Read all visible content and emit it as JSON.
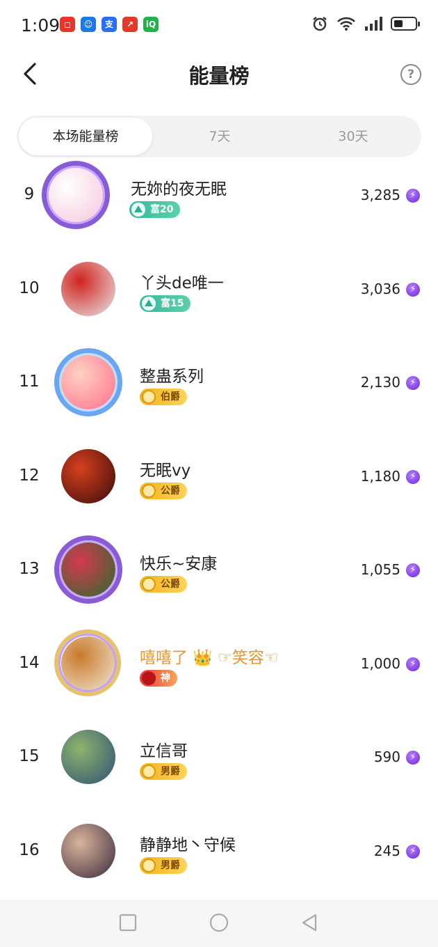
{
  "status_bar": {
    "time": "1:09",
    "notif_apps": [
      {
        "name": "app-icon-red",
        "color": "#e8342b",
        "glyph": "◻"
      },
      {
        "name": "app-icon-blue-bot",
        "color": "#1e78e6",
        "glyph": "☺"
      },
      {
        "name": "app-icon-alipay",
        "color": "#2a6ff0",
        "glyph": "支"
      },
      {
        "name": "app-icon-red-arrow",
        "color": "#e23a2a",
        "glyph": "↗"
      },
      {
        "name": "app-icon-iqiyi",
        "color": "#22b24c",
        "glyph": "iQ"
      }
    ]
  },
  "header": {
    "title": "能量榜",
    "help": "?"
  },
  "tabs": [
    {
      "label": "本场能量榜",
      "active": true
    },
    {
      "label": "7天",
      "active": false
    },
    {
      "label": "30天",
      "active": false
    }
  ],
  "rows": [
    {
      "rank": "9",
      "name": "无妳的夜无眠",
      "badge": "富20",
      "badge_type": "rich",
      "score": "3,285",
      "frame": "purple",
      "avatar_colors": [
        "#f5c6dc",
        "#ffffff"
      ]
    },
    {
      "rank": "10",
      "name": "丫头de唯一",
      "badge": "富15",
      "badge_type": "rich",
      "score": "3,036",
      "frame": "none",
      "avatar_colors": [
        "#e8e8e8",
        "#d0231f"
      ]
    },
    {
      "rank": "11",
      "name": "整蛊系列",
      "badge": "伯爵",
      "badge_type": "gold",
      "score": "2,130",
      "frame": "blue",
      "avatar_colors": [
        "#ff6f8c",
        "#ffd1c4"
      ]
    },
    {
      "rank": "12",
      "name": "无眠vy",
      "badge": "公爵",
      "badge_type": "gold",
      "score": "1,180",
      "frame": "none",
      "avatar_colors": [
        "#3a0b0b",
        "#d6401e"
      ]
    },
    {
      "rank": "13",
      "name": "快乐~安康",
      "badge": "公爵",
      "badge_type": "gold",
      "score": "1,055",
      "frame": "purple",
      "avatar_colors": [
        "#2c6b2a",
        "#d43a52"
      ]
    },
    {
      "rank": "14",
      "name": "嘻嘻了 👑 ☞笑容☜",
      "badge": "神",
      "badge_type": "red",
      "score": "1,000",
      "frame": "gold",
      "avatar_colors": [
        "#f3e7d7",
        "#c87a2a"
      ]
    },
    {
      "rank": "15",
      "name": "立信哥",
      "badge": "男爵",
      "badge_type": "gold",
      "score": "590",
      "frame": "none",
      "avatar_colors": [
        "#2c5277",
        "#8fb36a"
      ]
    },
    {
      "rank": "16",
      "name": "静静地丶守候",
      "badge": "男爵",
      "badge_type": "gold",
      "score": "245",
      "frame": "none",
      "avatar_colors": [
        "#3b2a3a",
        "#d9b49c"
      ]
    }
  ],
  "energy_glyph": "⚡"
}
